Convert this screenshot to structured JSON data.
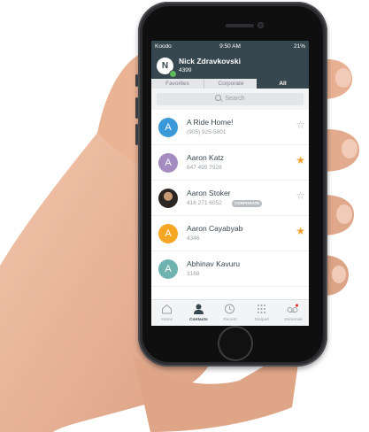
{
  "status_bar": {
    "carrier": "Koodo",
    "time": "9:50 AM",
    "battery": "21%"
  },
  "header": {
    "user_initial": "N",
    "user_name": "Nick Zdravkovski",
    "extension": "4399"
  },
  "tabs": [
    {
      "label": "Favorites",
      "active": false
    },
    {
      "label": "Corporate",
      "active": false
    },
    {
      "label": "All",
      "active": true
    }
  ],
  "search": {
    "placeholder": "Search"
  },
  "contacts": [
    {
      "initial": "A",
      "name": "A Ride Home!",
      "number": "(905) 925-5801",
      "favorite": false,
      "avatar_color": "#3a9ad9"
    },
    {
      "initial": "A",
      "name": "Aaron Katz",
      "number": "647 495 7928",
      "favorite": true,
      "avatar_color": "#a58cc0"
    },
    {
      "initial": "",
      "name": "Aaron Stoker",
      "number": "416 271 6052",
      "badge": "CORPORATE",
      "favorite": false,
      "avatar_color": "#333333"
    },
    {
      "initial": "A",
      "name": "Aaron Cayabyab",
      "number": "4346",
      "favorite": true,
      "avatar_color": "#f5a623"
    },
    {
      "initial": "A",
      "name": "Abhinav Kavuru",
      "number": "3168",
      "favorite": false,
      "avatar_color": "#6fb3b0"
    }
  ],
  "tab_bar": [
    {
      "label": "Home",
      "icon": "home-icon",
      "active": false
    },
    {
      "label": "Contacts",
      "icon": "person-icon",
      "active": true
    },
    {
      "label": "Recent",
      "icon": "clock-icon",
      "active": false
    },
    {
      "label": "Dialpad",
      "icon": "dialpad-icon",
      "active": false
    },
    {
      "label": "Voicemail",
      "icon": "voicemail-icon",
      "active": false
    }
  ],
  "colors": {
    "header_bg": "#37474f",
    "accent_star": "#f0a030"
  }
}
